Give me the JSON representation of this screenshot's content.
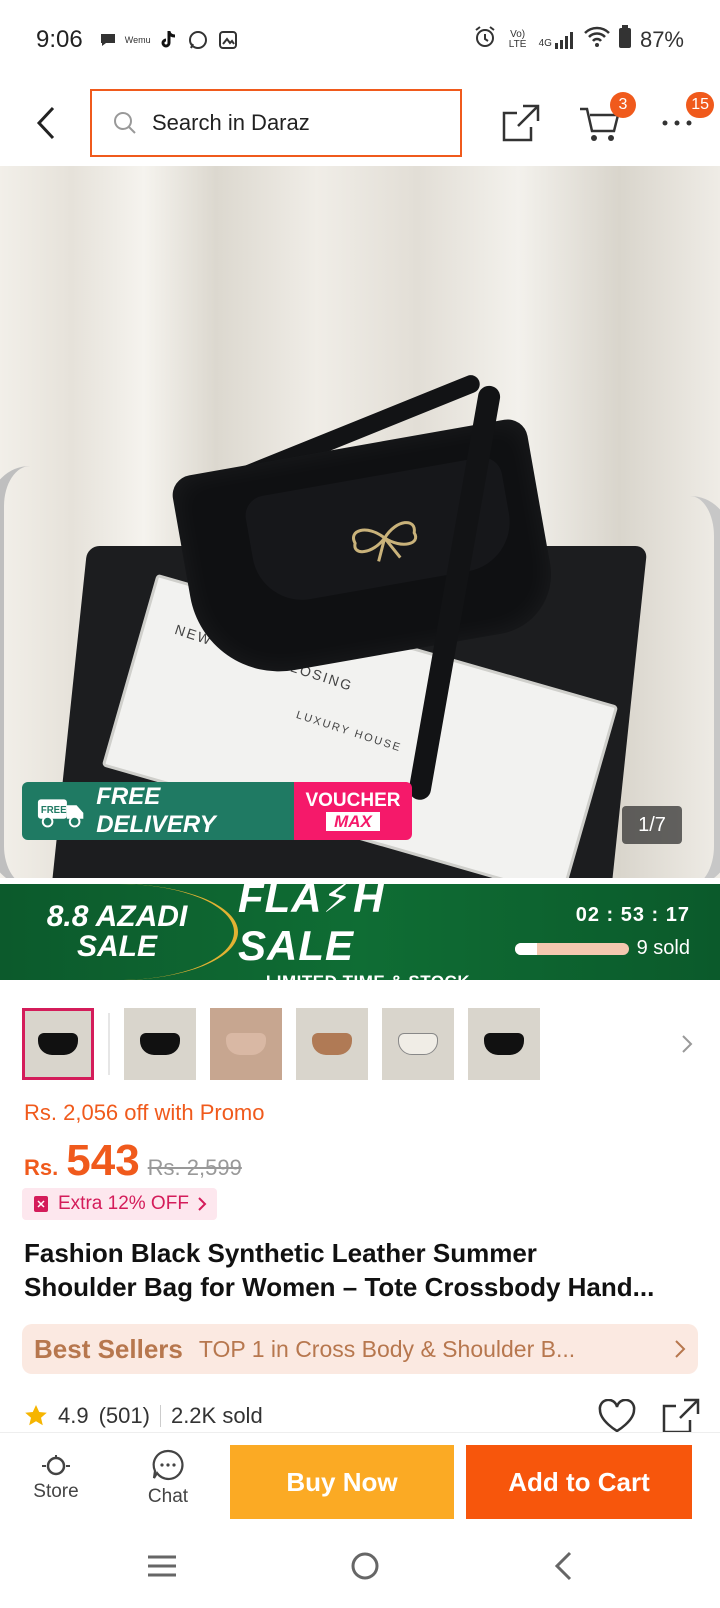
{
  "status_bar": {
    "time": "9:06",
    "battery": "87%",
    "network": "4G",
    "volte": "Vo) LTE",
    "app_icons": [
      "chat-bubble-icon",
      "wemu-icon",
      "tiktok-icon",
      "whatsapp-icon",
      "gallery-icon"
    ]
  },
  "header": {
    "search_placeholder": "Search in Daraz",
    "cart_count": "3",
    "more_count": "15"
  },
  "gallery": {
    "free_delivery": "FREE DELIVERY",
    "free_tag": "FREE",
    "voucher_top": "VOUCHER",
    "voucher_bottom": "MAX",
    "counter": "1/7",
    "book_text": "NEW URBAN CLOSING",
    "book_text2": "LUXURY HOUSE"
  },
  "flash_sale": {
    "azadi_line1": "8.8 AZADI",
    "azadi_line2": "SALE",
    "title": "FLA⚡H SALE",
    "subtitle": "LIMITED TIME & STOCK",
    "countdown": "02 : 53 : 17",
    "sold": "9 sold",
    "sold_progress": 0.2
  },
  "thumbnails": {
    "count": 6
  },
  "price": {
    "promo": "Rs. 2,056 off with Promo",
    "currency": "Rs.",
    "current": "543",
    "original": "Rs. 2,599",
    "extra": "Extra 12% OFF"
  },
  "product": {
    "title_line1": "Fashion Black Synthetic Leather Summer",
    "title_line2": "Shoulder Bag for Women – Tote Crossbody Hand..."
  },
  "best_seller": {
    "label": "Best Sellers",
    "text": "TOP 1 in Cross Body & Shoulder B..."
  },
  "rating": {
    "score": "4.9",
    "count": "(501)",
    "sold": "2.2K sold"
  },
  "actions": {
    "store": "Store",
    "chat": "Chat",
    "buy_now": "Buy Now",
    "add_to_cart": "Add to Cart"
  },
  "colors": {
    "accent": "#f05a1c",
    "buy_now": "#fbaa24",
    "add_to_cart": "#f7560c",
    "flash_green": "#0f6d34",
    "voucher_pink": "#f5196a"
  }
}
